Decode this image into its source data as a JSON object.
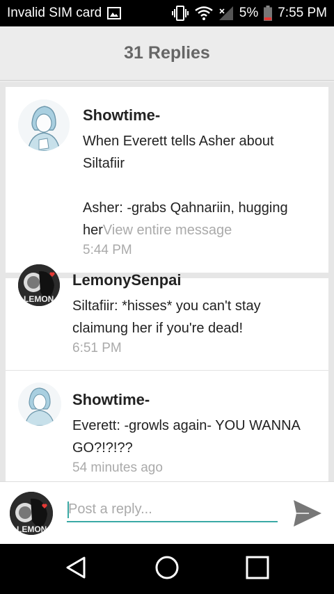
{
  "status_bar": {
    "carrier": "Invalid SIM card",
    "battery_percent": "5%",
    "time": "7:55 PM",
    "icons": [
      "image-icon",
      "vibrate-icon",
      "wifi-icon",
      "signal-icon",
      "battery-icon"
    ]
  },
  "header": {
    "title": "31 Replies"
  },
  "replies": [
    {
      "author": "Showtime-",
      "text_line1": "When Everett tells Asher about",
      "text_line2": "Siltafiir",
      "text_line3": "Asher: -grabs Qahnariin, hugging",
      "text_line4": "her",
      "more_link": "View entire message",
      "time": "5:44 PM"
    },
    {
      "author": "LemonySenpai",
      "text_line1": "Siltafiir: *hisses* you can't stay",
      "text_line2": "claimung her if you're dead!",
      "time": "6:51 PM"
    },
    {
      "author": "Showtime-",
      "text_line1": "Everett: -growls again- YOU WANNA",
      "text_line2": "GO?!?!??",
      "time": "54 minutes ago"
    }
  ],
  "composer": {
    "placeholder": "Post a reply..."
  },
  "colors": {
    "accent": "#3aa9a5",
    "status_bar": "#000000",
    "header_bg": "#ececec"
  }
}
